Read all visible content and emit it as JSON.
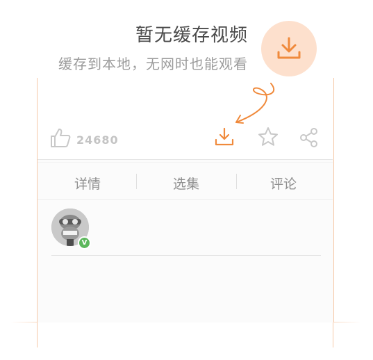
{
  "prompt": {
    "title": "暂无缓存视频",
    "subtitle": "缓存到本地，无网时也能观看"
  },
  "toolbar": {
    "like_count": "24680"
  },
  "tabs": [
    {
      "label": "详情"
    },
    {
      "label": "选集"
    },
    {
      "label": "评论"
    }
  ],
  "colors": {
    "accent": "#f08a3c",
    "accent_light": "#fde0cd",
    "verified": "#5cb85c"
  },
  "icons": {
    "hero": "download-icon",
    "like": "thumbs-up-icon",
    "download": "download-icon",
    "favorite": "star-icon",
    "share": "share-icon"
  }
}
